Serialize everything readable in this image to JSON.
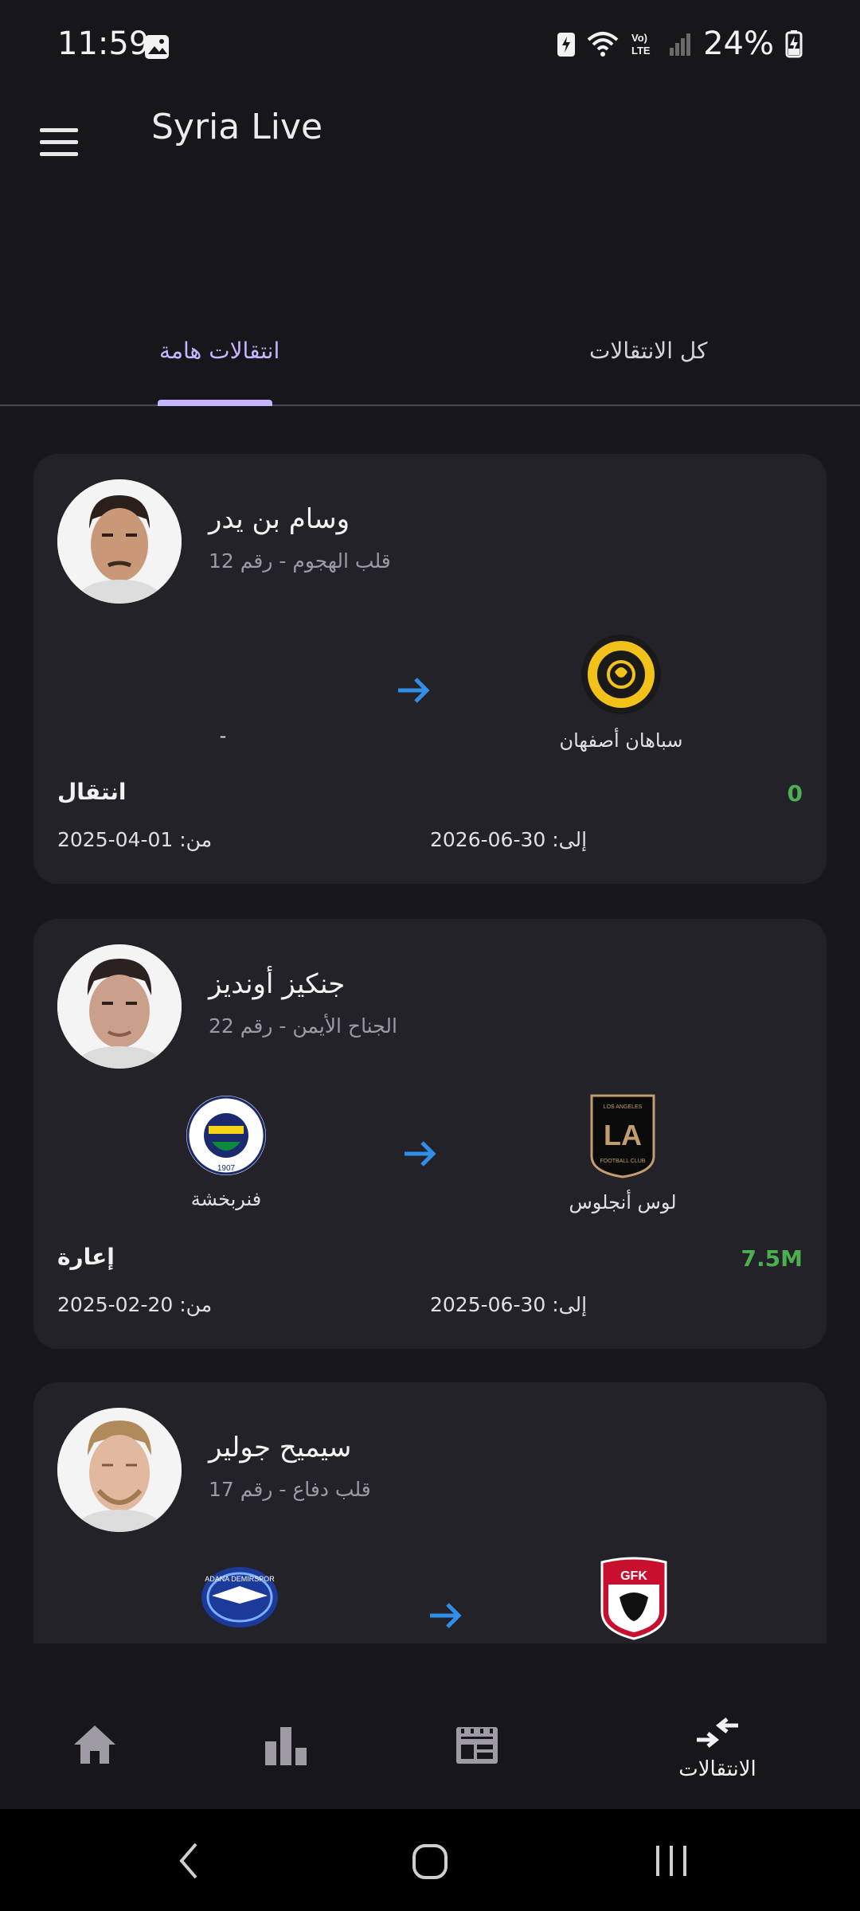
{
  "status": {
    "time": "11:59",
    "battery": "24%",
    "volte": "Vo)\nLTE"
  },
  "app": {
    "title": "Syria Live"
  },
  "tabs": [
    {
      "label": "انتقالات هامة",
      "active": true
    },
    {
      "label": "كل الانتقالات",
      "active": false
    }
  ],
  "transfers": [
    {
      "name": "وسام بن يدر",
      "position_number": "قلب الهجوم - رقم 12",
      "from_club": "-",
      "to_club": "سباهان أصفهان",
      "type": "انتقال",
      "fee": "0",
      "from_date": "من: 01-04-2025",
      "to_date": "إلى: 30-06-2026"
    },
    {
      "name": "جنكيز أونديز",
      "position_number": "الجناح الأيمن - رقم 22",
      "from_club": "فنربخشة",
      "to_club": "لوس أنجلوس",
      "type": "إعارة",
      "fee": "7.5M",
      "from_date": "من: 20-02-2025",
      "to_date": "إلى: 30-06-2025"
    },
    {
      "name": "سيميح جولير",
      "position_number": "قلب دفاع - رقم 17",
      "from_club": "",
      "to_club": "",
      "type": "",
      "fee": "",
      "from_date": "",
      "to_date": ""
    }
  ],
  "crest_text": {
    "lafc_top": "LOS ANGELES",
    "lafc_mono": "LA",
    "lafc_bottom": "FOOTBALL CLUB",
    "fenerbahce_ring": "FENERBAHÇE SPOR KULÜBÜ",
    "fenerbahce_year": "1907",
    "adana": "ADANA DEMIRSPOR",
    "gfk": "GFK"
  },
  "bottom_nav": {
    "items": [
      "home-icon",
      "stats-icon",
      "table-icon",
      "transfers-icon"
    ],
    "transfers_label": "الانتقالات"
  },
  "colors": {
    "accent": "#c7b6ff",
    "fee_green": "#4caf50",
    "arrow_blue": "#2f8fe8"
  }
}
